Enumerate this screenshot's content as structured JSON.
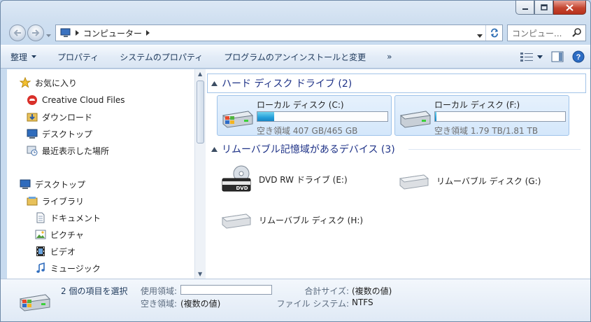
{
  "window": {
    "title": ""
  },
  "address": {
    "crumbs": [
      "コンピューター"
    ],
    "search_placeholder": "コンピュー..."
  },
  "toolbar": {
    "organize": "整理",
    "properties": "プロパティ",
    "system_properties": "システムのプロパティ",
    "uninstall": "プログラムのアンインストールと変更",
    "more": "»"
  },
  "sidebar": {
    "favorites": "お気に入り",
    "items": [
      {
        "label": "Creative Cloud Files",
        "icon": "creative-cloud-icon"
      },
      {
        "label": "ダウンロード",
        "icon": "downloads-folder-icon"
      },
      {
        "label": "デスクトップ",
        "icon": "desktop-icon"
      },
      {
        "label": "最近表示した場所",
        "icon": "recent-places-icon"
      }
    ],
    "desktop": "デスクトップ",
    "libraries": "ライブラリ",
    "library_items": [
      {
        "label": "ドキュメント",
        "icon": "documents-icon"
      },
      {
        "label": "ピクチャ",
        "icon": "pictures-icon"
      },
      {
        "label": "ビデオ",
        "icon": "videos-icon"
      },
      {
        "label": "ミュージック",
        "icon": "music-icon"
      }
    ]
  },
  "content": {
    "hard_disks_header": "ハード ディスク ドライブ (2)",
    "drives": [
      {
        "name": "ローカル ディスク (C:)",
        "free": "空き領域 407 GB/465 GB",
        "used_fraction": 0.13
      },
      {
        "name": "ローカル ディスク (F:)",
        "free": "空き領域 1.79 TB/1.81 TB",
        "used_fraction": 0.01
      }
    ],
    "removable_header": "リムーバブル記憶域があるデバイス (3)",
    "removable": [
      {
        "name": "DVD RW ドライブ (E:)",
        "icon": "dvd-drive-icon"
      },
      {
        "name": "リムーバブル ディスク (G:)",
        "icon": "removable-disk-icon"
      },
      {
        "name": "リムーバブル ディスク (H:)",
        "icon": "removable-disk-icon"
      }
    ]
  },
  "details": {
    "title": "2 個の項目を選択",
    "used_label": "使用領域:",
    "free_label": "空き領域:",
    "free_value": "(複数の値)",
    "total_label": "合計サイズ:",
    "total_value": "(複数の値)",
    "fs_label": "ファイル システム:",
    "fs_value": "NTFS"
  },
  "colors": {
    "accent_link": "#1e3287",
    "selection_bg": "#d4e7fb",
    "bar_fill": "#26a0da"
  }
}
